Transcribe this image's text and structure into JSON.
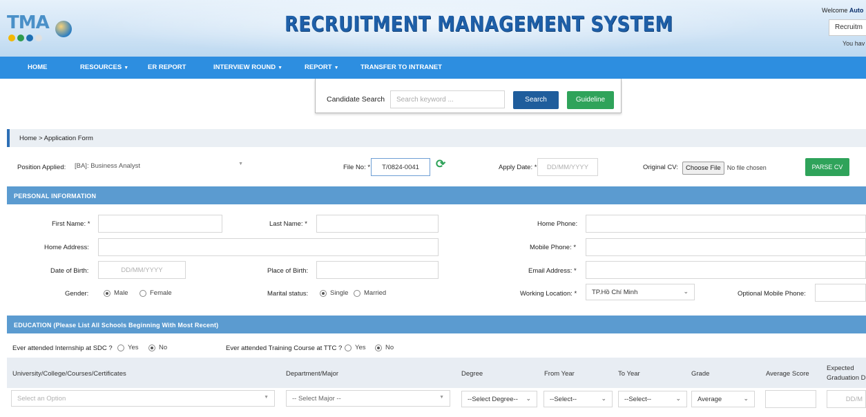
{
  "header": {
    "logo_text": "TMA",
    "logo_dot_colors": [
      "#f2b705",
      "#2e9b4e",
      "#1f6fb3",
      "#e0e0e0"
    ],
    "title": "RECRUITMENT MANAGEMENT SYSTEM",
    "welcome_prefix": "Welcome ",
    "welcome_user": "Auto",
    "role_value": "Recruitm",
    "you_have": "You hav"
  },
  "nav": {
    "items": [
      {
        "label": "HOME",
        "dropdown": false
      },
      {
        "label": "RESOURCES",
        "dropdown": true
      },
      {
        "label": "ER REPORT",
        "dropdown": false
      },
      {
        "label": "INTERVIEW ROUND",
        "dropdown": true
      },
      {
        "label": "REPORT",
        "dropdown": true
      },
      {
        "label": "TRANSFER TO INTRANET",
        "dropdown": false
      }
    ],
    "caret": "▼"
  },
  "search": {
    "label": "Candidate Search",
    "placeholder": "Search keyword ...",
    "search_button": "Search",
    "guideline_button": "Guideline"
  },
  "breadcrumb": "Home  >  Application Form",
  "top_row": {
    "position_label": "Position Applied:",
    "position_value": "[BA]: Business Analyst",
    "file_no_label": "File No: *",
    "file_no_value": "T/0824-0041",
    "apply_date_label": "Apply Date: *",
    "apply_date_placeholder": "DD/MM/YYYY",
    "original_cv_label": "Original CV:",
    "choose_file": "Choose File",
    "no_file": "No file chosen",
    "parse_cv": "PARSE CV"
  },
  "personal": {
    "section_title": "PERSONAL INFORMATION",
    "first_name_label": "First Name: *",
    "last_name_label": "Last Name: *",
    "home_phone_label": "Home Phone:",
    "home_address_label": "Home Address:",
    "mobile_phone_label": "Mobile Phone: *",
    "dob_label": "Date of Birth:",
    "dob_placeholder": "DD/MM/YYYY",
    "pob_label": "Place of Birth:",
    "email_label": "Email Address: *",
    "gender_label": "Gender:",
    "gender_male": "Male",
    "gender_female": "Female",
    "marital_label": "Marital status:",
    "marital_single": "Single",
    "marital_married": "Married",
    "working_location_label": "Working Location: *",
    "working_location_value": "TP.Hồ Chí Minh",
    "optional_mobile_label": "Optional Mobile Phone:"
  },
  "education": {
    "section_title": "EDUCATION (Please List All Schools Beginning With Most Recent)",
    "internship_q": "Ever attended Internship at SDC ?",
    "training_q": "Ever attended Training Course at TTC ?",
    "yes": "Yes",
    "no": "No",
    "columns": [
      "University/College/Courses/Certificates",
      "Department/Major",
      "Degree",
      "From Year",
      "To Year",
      "Grade",
      "Average Score",
      "Expected",
      "Graduation D"
    ],
    "row": {
      "school_placeholder": "Select an Option",
      "major_placeholder": "-- Select Major --",
      "degree": "--Select Degree--",
      "from_year": "--Select--",
      "to_year": "--Select--",
      "grade": "Average",
      "expected_date": "DD/M"
    }
  },
  "colors": {
    "nav_blue": "#2d8ee0",
    "section_blue": "#5b9bd0",
    "button_blue": "#1f5d9c",
    "button_green": "#2fa35a"
  }
}
